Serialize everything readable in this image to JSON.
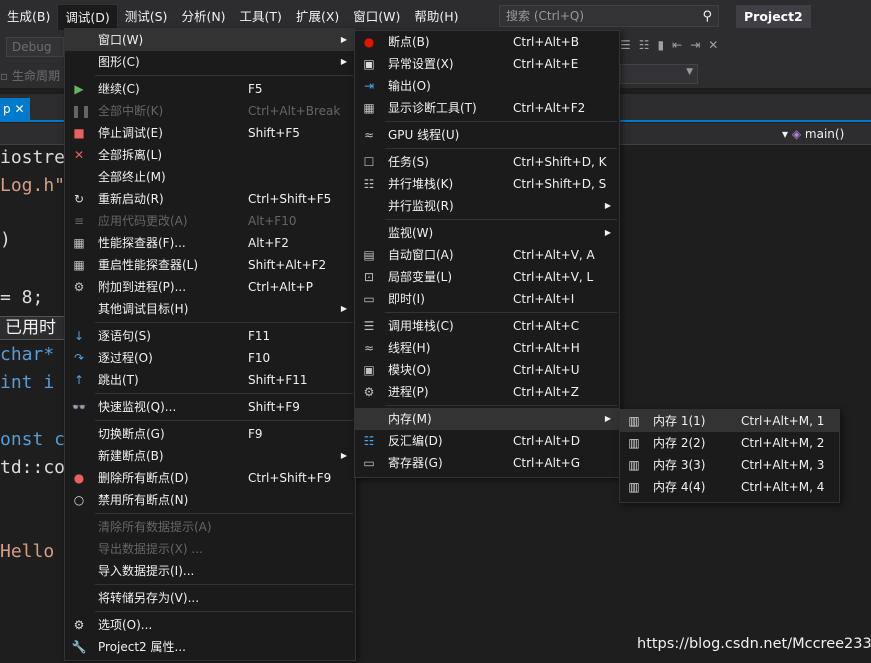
{
  "menubar": {
    "items": [
      "生成(B)",
      "调试(D)",
      "测试(S)",
      "分析(N)",
      "工具(T)",
      "扩展(X)",
      "窗口(W)",
      "帮助(H)"
    ],
    "search_placeholder": "搜索 (Ctrl+Q)",
    "project_title": "Project2"
  },
  "toolbar": {
    "config": "Debug",
    "lifecycle": "生命周期"
  },
  "tabs": {
    "doc_tab": "p"
  },
  "navbar": {
    "function": "main()"
  },
  "code": {
    "l1": "iostre",
    "l2": "Log.h\"",
    "l3": ")",
    "l4": " = 8;",
    "usage": "已用时",
    "l5": " char*",
    "l6": "int i ",
    "l7": "onst c",
    "l8": "td::co",
    "l9": "Hello "
  },
  "debug_menu": [
    {
      "type": "item",
      "icon": "window-icon",
      "glyph": "",
      "label": "窗口(W)",
      "shortcut": "",
      "sub": true,
      "disabled": false,
      "hl": true
    },
    {
      "type": "item",
      "icon": "graphics-icon",
      "glyph": "",
      "label": "图形(C)",
      "shortcut": "",
      "sub": true,
      "disabled": false
    },
    {
      "type": "sep"
    },
    {
      "type": "item",
      "icon": "continue-icon",
      "glyph": "▶",
      "color": "#5fb85f",
      "label": "继续(C)",
      "shortcut": "F5",
      "sub": false,
      "disabled": false
    },
    {
      "type": "item",
      "icon": "break-all-icon",
      "glyph": "❚❚",
      "color": "#656565",
      "label": "全部中断(K)",
      "shortcut": "Ctrl+Alt+Break",
      "sub": false,
      "disabled": true
    },
    {
      "type": "item",
      "icon": "stop-icon",
      "glyph": "■",
      "color": "#e8615d",
      "label": "停止调试(E)",
      "shortcut": "Shift+F5",
      "sub": false,
      "disabled": false
    },
    {
      "type": "item",
      "icon": "detach-all-icon",
      "glyph": "✕",
      "color": "#e8615d",
      "label": "全部拆离(L)",
      "shortcut": "",
      "sub": false,
      "disabled": false
    },
    {
      "type": "item",
      "icon": "terminate-all-icon",
      "glyph": "",
      "label": "全部终止(M)",
      "shortcut": "",
      "sub": false,
      "disabled": false
    },
    {
      "type": "item",
      "icon": "restart-icon",
      "glyph": "↻",
      "color": "#dcdcdc",
      "label": "重新启动(R)",
      "shortcut": "Ctrl+Shift+F5",
      "sub": false,
      "disabled": false
    },
    {
      "type": "item",
      "icon": "apply-code-changes-icon",
      "glyph": "≡",
      "color": "#656565",
      "label": "应用代码更改(A)",
      "shortcut": "Alt+F10",
      "sub": false,
      "disabled": true
    },
    {
      "type": "item",
      "icon": "profiler-icon",
      "glyph": "▦",
      "color": "#c0c0c0",
      "label": "性能探查器(F)...",
      "shortcut": "Alt+F2",
      "sub": false,
      "disabled": false
    },
    {
      "type": "item",
      "icon": "restart-profiler-icon",
      "glyph": "▦",
      "color": "#c0c0c0",
      "label": "重启性能探查器(L)",
      "shortcut": "Shift+Alt+F2",
      "sub": false,
      "disabled": false
    },
    {
      "type": "item",
      "icon": "attach-process-icon",
      "glyph": "⚙",
      "color": "#c0c0c0",
      "label": "附加到进程(P)...",
      "shortcut": "Ctrl+Alt+P",
      "sub": false,
      "disabled": false
    },
    {
      "type": "item",
      "icon": "",
      "glyph": "",
      "label": "其他调试目标(H)",
      "shortcut": "",
      "sub": true,
      "disabled": false
    },
    {
      "type": "sep"
    },
    {
      "type": "item",
      "icon": "step-into-icon",
      "glyph": "↓",
      "color": "#4ea3e8",
      "label": "逐语句(S)",
      "shortcut": "F11",
      "sub": false,
      "disabled": false
    },
    {
      "type": "item",
      "icon": "step-over-icon",
      "glyph": "↷",
      "color": "#4ea3e8",
      "label": "逐过程(O)",
      "shortcut": "F10",
      "sub": false,
      "disabled": false
    },
    {
      "type": "item",
      "icon": "step-out-icon",
      "glyph": "↑",
      "color": "#4ea3e8",
      "label": "跳出(T)",
      "shortcut": "Shift+F11",
      "sub": false,
      "disabled": false
    },
    {
      "type": "sep"
    },
    {
      "type": "item",
      "icon": "quick-watch-icon",
      "glyph": "👓",
      "color": "#dcdcdc",
      "label": "快速监视(Q)...",
      "shortcut": "Shift+F9",
      "sub": false,
      "disabled": false
    },
    {
      "type": "sep"
    },
    {
      "type": "item",
      "icon": "",
      "glyph": "",
      "label": "切换断点(G)",
      "shortcut": "F9",
      "sub": false,
      "disabled": false
    },
    {
      "type": "item",
      "icon": "",
      "glyph": "",
      "label": "新建断点(B)",
      "shortcut": "",
      "sub": true,
      "disabled": false
    },
    {
      "type": "item",
      "icon": "delete-breakpoints-icon",
      "glyph": "●",
      "color": "#e8615d",
      "label": "删除所有断点(D)",
      "shortcut": "Ctrl+Shift+F9",
      "sub": false,
      "disabled": false
    },
    {
      "type": "item",
      "icon": "disable-breakpoints-icon",
      "glyph": "○",
      "color": "#dcdcdc",
      "label": "禁用所有断点(N)",
      "shortcut": "",
      "sub": false,
      "disabled": false
    },
    {
      "type": "sep"
    },
    {
      "type": "item",
      "icon": "",
      "glyph": "",
      "label": "清除所有数据提示(A)",
      "shortcut": "",
      "sub": false,
      "disabled": true
    },
    {
      "type": "item",
      "icon": "",
      "glyph": "",
      "label": "导出数据提示(X) ...",
      "shortcut": "",
      "sub": false,
      "disabled": true
    },
    {
      "type": "item",
      "icon": "",
      "glyph": "",
      "label": "导入数据提示(I)...",
      "shortcut": "",
      "sub": false,
      "disabled": false
    },
    {
      "type": "sep"
    },
    {
      "type": "item",
      "icon": "",
      "glyph": "",
      "label": "将转储另存为(V)...",
      "shortcut": "",
      "sub": false,
      "disabled": false
    },
    {
      "type": "sep"
    },
    {
      "type": "item",
      "icon": "options-icon",
      "glyph": "⚙",
      "color": "#dcdcdc",
      "label": "选项(O)...",
      "shortcut": "",
      "sub": false,
      "disabled": false
    },
    {
      "type": "item",
      "icon": "properties-icon",
      "glyph": "🔧",
      "color": "#dcdcdc",
      "label": "Project2 属性...",
      "shortcut": "",
      "sub": false,
      "disabled": false
    }
  ],
  "window_menu": [
    {
      "type": "item",
      "icon": "breakpoint-icon",
      "glyph": "●",
      "color": "#e51400",
      "label": "断点(B)",
      "shortcut": "Ctrl+Alt+B",
      "sub": false
    },
    {
      "type": "item",
      "icon": "exception-settings-icon",
      "glyph": "▣",
      "color": "#dcdcdc",
      "label": "异常设置(X)",
      "shortcut": "Ctrl+Alt+E",
      "sub": false
    },
    {
      "type": "item",
      "icon": "output-icon",
      "glyph": "⇥",
      "color": "#4ea3e8",
      "label": "输出(O)",
      "shortcut": "",
      "sub": false
    },
    {
      "type": "item",
      "icon": "diagnostic-tools-icon",
      "glyph": "▦",
      "color": "#c0c0c0",
      "label": "显示诊断工具(T)",
      "shortcut": "Ctrl+Alt+F2",
      "sub": false
    },
    {
      "type": "sep"
    },
    {
      "type": "item",
      "icon": "gpu-threads-icon",
      "glyph": "≈",
      "color": "#c0c0c0",
      "label": "GPU 线程(U)",
      "shortcut": "",
      "sub": false
    },
    {
      "type": "sep"
    },
    {
      "type": "item",
      "icon": "tasks-icon",
      "glyph": "☐",
      "color": "#c0c0c0",
      "label": "任务(S)",
      "shortcut": "Ctrl+Shift+D, K",
      "sub": false
    },
    {
      "type": "item",
      "icon": "parallel-stacks-icon",
      "glyph": "☷",
      "color": "#c0c0c0",
      "label": "并行堆栈(K)",
      "shortcut": "Ctrl+Shift+D, S",
      "sub": false
    },
    {
      "type": "item",
      "icon": "",
      "glyph": "",
      "label": "并行监视(R)",
      "shortcut": "",
      "sub": true
    },
    {
      "type": "sep"
    },
    {
      "type": "item",
      "icon": "",
      "glyph": "",
      "label": "监视(W)",
      "shortcut": "",
      "sub": true
    },
    {
      "type": "item",
      "icon": "autos-icon",
      "glyph": "▤",
      "color": "#c0c0c0",
      "label": "自动窗口(A)",
      "shortcut": "Ctrl+Alt+V, A",
      "sub": false
    },
    {
      "type": "item",
      "icon": "locals-icon",
      "glyph": "⊡",
      "color": "#c0c0c0",
      "label": "局部变量(L)",
      "shortcut": "Ctrl+Alt+V, L",
      "sub": false
    },
    {
      "type": "item",
      "icon": "immediate-icon",
      "glyph": "▭",
      "color": "#c0c0c0",
      "label": "即时(I)",
      "shortcut": "Ctrl+Alt+I",
      "sub": false
    },
    {
      "type": "sep"
    },
    {
      "type": "item",
      "icon": "call-stack-icon",
      "glyph": "☰",
      "color": "#c0c0c0",
      "label": "调用堆栈(C)",
      "shortcut": "Ctrl+Alt+C",
      "sub": false
    },
    {
      "type": "item",
      "icon": "threads-icon",
      "glyph": "≈",
      "color": "#c0c0c0",
      "label": "线程(H)",
      "shortcut": "Ctrl+Alt+H",
      "sub": false
    },
    {
      "type": "item",
      "icon": "modules-icon",
      "glyph": "▣",
      "color": "#c0c0c0",
      "label": "模块(O)",
      "shortcut": "Ctrl+Alt+U",
      "sub": false
    },
    {
      "type": "item",
      "icon": "processes-icon",
      "glyph": "⚙",
      "color": "#c0c0c0",
      "label": "进程(P)",
      "shortcut": "Ctrl+Alt+Z",
      "sub": false
    },
    {
      "type": "sep"
    },
    {
      "type": "item",
      "icon": "",
      "glyph": "",
      "label": "内存(M)",
      "shortcut": "",
      "sub": true,
      "hl": true
    },
    {
      "type": "item",
      "icon": "disassembly-icon",
      "glyph": "☷",
      "color": "#4ea3e8",
      "label": "反汇编(D)",
      "shortcut": "Ctrl+Alt+D",
      "sub": false
    },
    {
      "type": "item",
      "icon": "registers-icon",
      "glyph": "▭",
      "color": "#c0c0c0",
      "label": "寄存器(G)",
      "shortcut": "Ctrl+Alt+G",
      "sub": false
    }
  ],
  "memory_menu": [
    {
      "type": "item",
      "icon": "memory-chip-icon",
      "glyph": "▥",
      "color": "#dcdcdc",
      "label": "内存 1(1)",
      "shortcut": "Ctrl+Alt+M, 1",
      "hl": true
    },
    {
      "type": "item",
      "icon": "memory-chip-icon",
      "glyph": "▥",
      "color": "#dcdcdc",
      "label": "内存 2(2)",
      "shortcut": "Ctrl+Alt+M, 2"
    },
    {
      "type": "item",
      "icon": "memory-chip-icon",
      "glyph": "▥",
      "color": "#dcdcdc",
      "label": "内存 3(3)",
      "shortcut": "Ctrl+Alt+M, 3"
    },
    {
      "type": "item",
      "icon": "memory-chip-icon",
      "glyph": "▥",
      "color": "#dcdcdc",
      "label": "内存 4(4)",
      "shortcut": "Ctrl+Alt+M, 4"
    }
  ],
  "watermark": "https://blog.csdn.net/Mccree233",
  "colors": {
    "accent": "#007acc",
    "menu_bg": "#1b1b1c",
    "editor_bg": "#1e1e1e"
  }
}
